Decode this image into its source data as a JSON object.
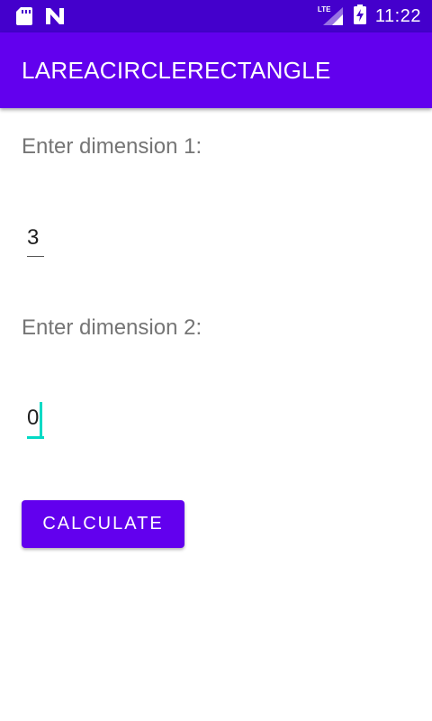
{
  "status_bar": {
    "time": "11:22",
    "network_label": "LTE",
    "icons": [
      "sd-card-icon",
      "n-logo-icon",
      "lte-signal-icon",
      "battery-charging-icon"
    ]
  },
  "app_bar": {
    "title": "LAREACIRCLERECTANGLE"
  },
  "form": {
    "dimension1_label": "Enter dimension 1:",
    "dimension1_value": "3",
    "dimension2_label": "Enter dimension 2:",
    "dimension2_value": "0",
    "calculate_label": "CALCULATE"
  },
  "colors": {
    "status_bar": "#4400cc",
    "primary": "#6200ee",
    "accent": "#03dac5",
    "label_text": "#757575"
  }
}
